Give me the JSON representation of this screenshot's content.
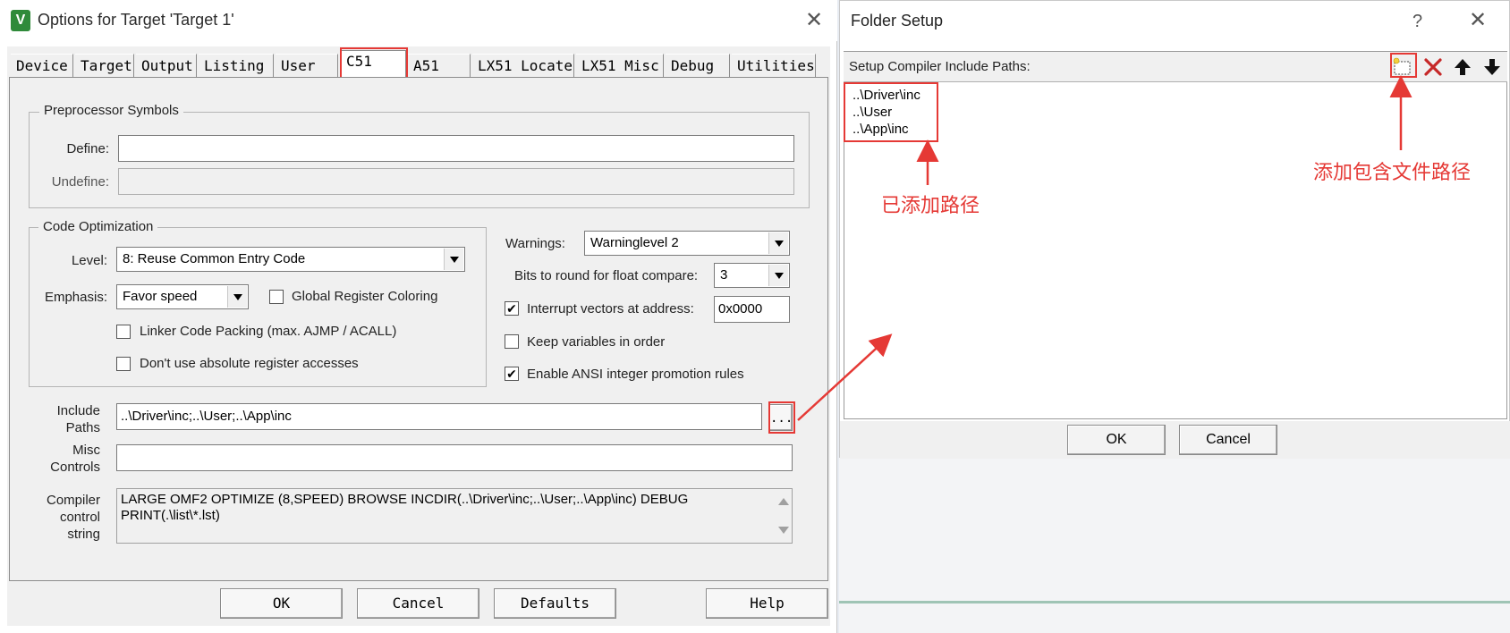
{
  "options_dialog": {
    "title": "Options for Target 'Target 1'",
    "app_icon_text": "V",
    "close_glyph": "✕",
    "tabs": [
      {
        "label": "Device"
      },
      {
        "label": "Target"
      },
      {
        "label": "Output"
      },
      {
        "label": "Listing"
      },
      {
        "label": "User"
      },
      {
        "label": "C51",
        "active": true
      },
      {
        "label": "A51"
      },
      {
        "label": "LX51 Locate"
      },
      {
        "label": "LX51 Misc"
      },
      {
        "label": "Debug"
      },
      {
        "label": "Utilities"
      }
    ],
    "preprocessor": {
      "title": "Preprocessor Symbols",
      "define_label": "Define:",
      "define_value": "",
      "undefine_label": "Undefine:",
      "undefine_value": ""
    },
    "code_optimization": {
      "title": "Code Optimization",
      "level_label": "Level:",
      "level_value": "8: Reuse Common Entry Code",
      "emphasis_label": "Emphasis:",
      "emphasis_value": "Favor speed",
      "global_register_coloring": {
        "label": "Global Register Coloring",
        "checked": false
      },
      "linker_code_packing": {
        "label": "Linker Code Packing (max. AJMP / ACALL)",
        "checked": false
      },
      "dont_use_absolute": {
        "label": "Don't use absolute register accesses",
        "checked": false
      }
    },
    "warnings": {
      "label": "Warnings:",
      "value": "Warninglevel 2",
      "bits_label": "Bits to round for float compare:",
      "bits_value": "3",
      "interrupt_vectors": {
        "label": "Interrupt vectors at address:",
        "checked": true,
        "value": "0x0000"
      },
      "keep_variables": {
        "label": "Keep variables in order",
        "checked": false
      },
      "ansi_promotion": {
        "label": "Enable ANSI integer promotion rules",
        "checked": true
      }
    },
    "include_paths": {
      "label_line1": "Include",
      "label_line2": "Paths",
      "value": "..\\Driver\\inc;..\\User;..\\App\\inc",
      "browse_label": "..."
    },
    "misc_controls": {
      "label_line1": "Misc",
      "label_line2": "Controls",
      "value": ""
    },
    "compiler_control": {
      "label_line1": "Compiler",
      "label_line2": "control",
      "label_line3": "string",
      "line1": "LARGE OMF2 OPTIMIZE (8,SPEED) BROWSE INCDIR(..\\Driver\\inc;..\\User;..\\App\\inc) DEBUG",
      "line2": "PRINT(.\\list\\*.lst)"
    },
    "buttons": {
      "ok": "OK",
      "cancel": "Cancel",
      "defaults": "Defaults",
      "help": "Help"
    }
  },
  "folder_setup": {
    "title": "Folder Setup",
    "help_glyph": "?",
    "close_glyph": "✕",
    "header_label": "Setup Compiler Include Paths:",
    "toolbar": [
      "new-folder-icon",
      "delete-icon",
      "move-up-icon",
      "move-down-icon"
    ],
    "paths": [
      "..\\Driver\\inc",
      "..\\User",
      "..\\App\\inc"
    ],
    "buttons": {
      "ok": "OK",
      "cancel": "Cancel"
    }
  },
  "annotations": {
    "added_paths": "已添加路径",
    "add_include_path": "添加包含文件路径"
  },
  "colors": {
    "annotation": "#e53935",
    "accent_green": "#2f8a3a"
  }
}
